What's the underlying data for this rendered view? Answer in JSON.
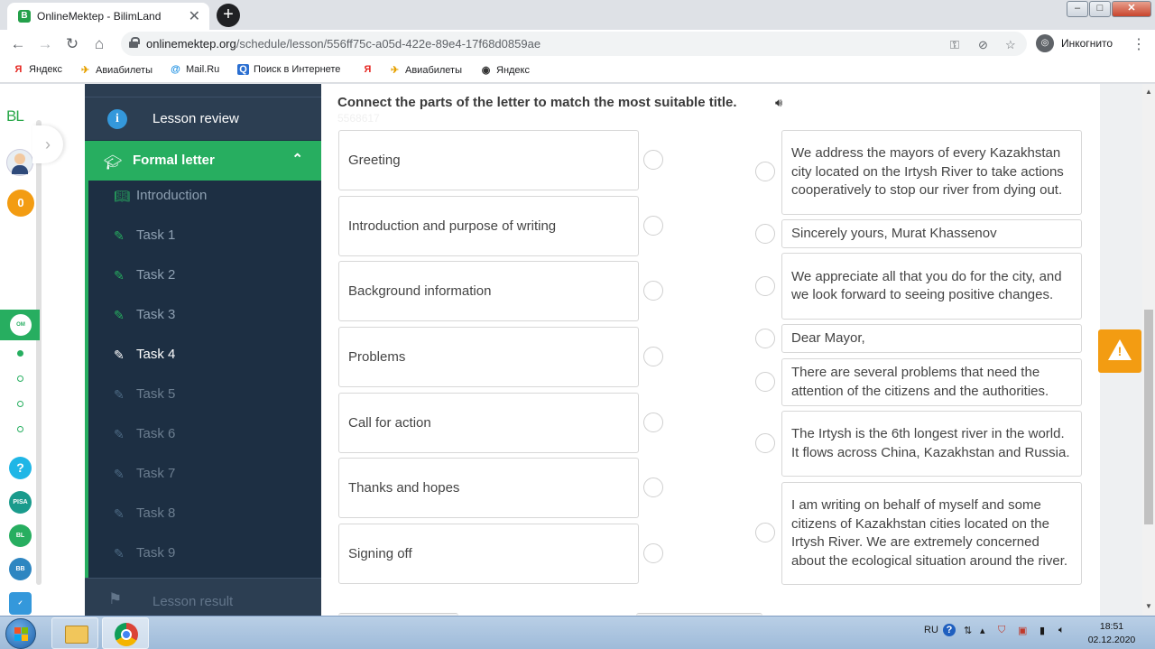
{
  "browser": {
    "tab_title": "OnlineMektep - BilimLand",
    "url_domain": "onlinemektep.org",
    "url_path": "/schedule/lesson/556ff75c-a05d-422e-89e4-17f68d0859ae",
    "profile_label": "Инкогнито"
  },
  "bookmarks": [
    {
      "label": "Яндекс",
      "icon": "yandex-icon"
    },
    {
      "label": "Авиабилеты",
      "icon": "plane-icon"
    },
    {
      "label": "Mail.Ru",
      "icon": "mailru-icon"
    },
    {
      "label": "Поиск в Интернете",
      "icon": "search-icon"
    },
    {
      "label": "",
      "icon": "yandex-icon"
    },
    {
      "label": "Авиабилеты",
      "icon": "plane-icon"
    },
    {
      "label": "Яндекс",
      "icon": "globe-icon"
    }
  ],
  "leftbar": {
    "logo": "BL",
    "score": "0"
  },
  "sidebar": {
    "lesson_review": "Lesson review",
    "section_title": "Formal letter",
    "items": [
      {
        "label": "Introduction",
        "icon": "book-icon"
      },
      {
        "label": "Task 1",
        "icon": "edit-icon"
      },
      {
        "label": "Task 2",
        "icon": "edit-icon"
      },
      {
        "label": "Task 3",
        "icon": "edit-icon"
      },
      {
        "label": "Task 4",
        "icon": "edit-icon"
      },
      {
        "label": "Task 5",
        "icon": "edit-icon"
      },
      {
        "label": "Task 6",
        "icon": "edit-icon"
      },
      {
        "label": "Task 7",
        "icon": "edit-icon"
      },
      {
        "label": "Task 8",
        "icon": "edit-icon"
      },
      {
        "label": "Task 9",
        "icon": "edit-icon"
      }
    ],
    "current_item": "Task 4",
    "lesson_result": "Lesson result"
  },
  "task": {
    "instruction": "Connect the parts of the letter to match the most suitable title.",
    "ghost_id": "5568617",
    "titles": [
      "Greeting",
      "Introduction and purpose of writing",
      "Background information",
      "Problems",
      "Call for action",
      "Thanks and hopes",
      "Signing off"
    ],
    "parts": [
      "We address the mayors of every Kazakhstan city located on the Irtysh River to take actions cooperatively to stop our river from dying out.",
      "Sincerely yours, Murat Khassenov",
      "We appreciate all that you do for the city, and we look forward to seeing positive changes.",
      "Dear Mayor,",
      "There are several problems that need the attention of the citizens and the authorities.",
      "The Irtysh is the 6th longest river in the world. It flows across China, Kazakhstan and Russia.",
      "I am writing on behalf of myself and some citizens of Kazakhstan cities located on the Irtysh River. We are extremely concerned about the ecological situation around the river."
    ]
  },
  "taskbar": {
    "lang": "RU",
    "time": "18:51",
    "date": "02.12.2020"
  },
  "colors": {
    "accent_green": "#27ae60",
    "sidebar_bg": "#1d2f43",
    "warning_orange": "#f39c12"
  }
}
